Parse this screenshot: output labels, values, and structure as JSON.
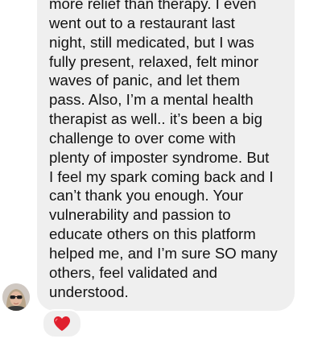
{
  "message": {
    "lines": [
      "more relief than therapy. I even",
      "went out to a restaurant last",
      "night, still medicated, but I was",
      "fully present, relaxed, felt minor",
      "waves of panic, and let them",
      "pass. Also, I’m a mental health",
      "therapist as well.. it’s been a big",
      "challenge to over come with",
      "plenty of imposter syndrome. But",
      "I feel my spark coming back and I",
      "can’t thank you enough. Your",
      "vulnerability and passion to",
      "educate others on this platform",
      "helped me, and I’m sure SO many",
      "others, feel validated and",
      "understood."
    ]
  },
  "reaction": {
    "icon": "red-heart-icon",
    "color": "#e0202e"
  },
  "colors": {
    "bubble": "#efefef",
    "text": "#111111",
    "background": "#ffffff"
  }
}
